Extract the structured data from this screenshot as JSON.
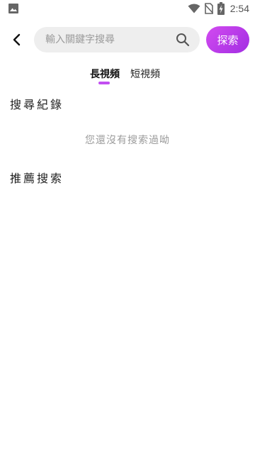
{
  "status_bar": {
    "time": "2:54"
  },
  "search": {
    "placeholder": "輸入關鍵字搜尋",
    "value": "",
    "submit_label": "探索"
  },
  "tabs": [
    {
      "label": "長視頻",
      "active": true
    },
    {
      "label": "短視頻",
      "active": false
    }
  ],
  "history": {
    "title": "搜尋紀錄",
    "empty_text": "您還沒有搜索過呦"
  },
  "recommend": {
    "title": "推薦搜索"
  },
  "colors": {
    "accent": "#c24ef1",
    "button_gradient_start": "#d24bf0",
    "button_gradient_end": "#a22ee2"
  },
  "icons": [
    "gallery-icon",
    "wifi-icon",
    "no-sim-icon",
    "battery-charging-icon",
    "back-arrow-icon",
    "search-icon"
  ]
}
